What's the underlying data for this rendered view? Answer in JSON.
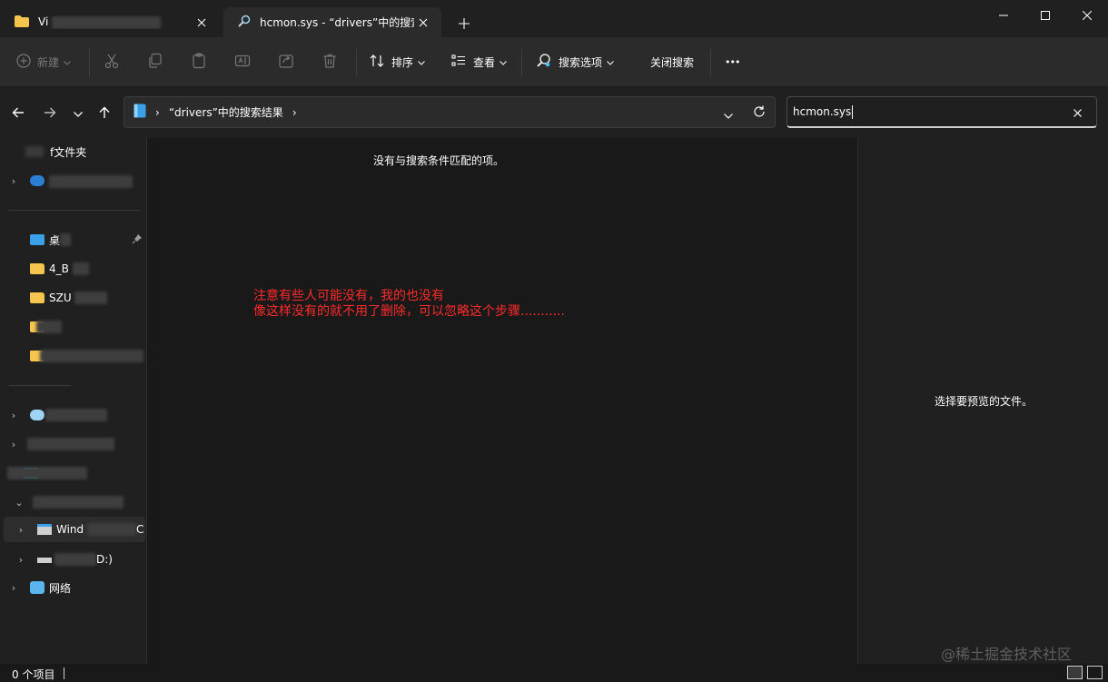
{
  "tabs": [
    {
      "title": "Vi",
      "icon": "folder-icon"
    },
    {
      "title": "hcmon.sys - “drivers”中的搜索",
      "icon": "search-icon",
      "active": true
    }
  ],
  "toolbar": {
    "new_label": "新建",
    "sort_label": "排序",
    "view_label": "查看",
    "search_options_label": "搜索选项",
    "close_search_label": "关闭搜索",
    "more_label": "•••"
  },
  "address": {
    "chevron_prefix": "›",
    "breadcrumb": "“drivers”中的搜索结果",
    "chevron_suffix": "›"
  },
  "search": {
    "value": "hcmon.sys"
  },
  "sidebar": {
    "items": [
      {
        "label": "f文件夹"
      },
      {
        "label": ""
      },
      {
        "label": "桌"
      },
      {
        "label": "4_B"
      },
      {
        "label": "SZU"
      },
      {
        "label": ""
      },
      {
        "label": ""
      },
      {
        "label": ""
      },
      {
        "label": ""
      },
      {
        "label": ""
      },
      {
        "label": ""
      },
      {
        "label": "Wind"
      },
      {
        "label": "D:)"
      },
      {
        "label": "网络"
      }
    ]
  },
  "main": {
    "empty_message": "没有与搜索条件匹配的项。"
  },
  "annotation": {
    "line1": "注意有些人可能没有，我的也没有",
    "line2": "像这样没有的就不用了删除，可以忽略这个步骤..........."
  },
  "preview": {
    "message": "选择要预览的文件。"
  },
  "status": {
    "item_count": "0 个项目"
  },
  "watermark": "@稀土掘金技术社区",
  "colors": {
    "background": "#191919",
    "toolbar": "#2b2b2b",
    "annotation": "#ff2a2a",
    "folder": "#f6c54d"
  }
}
